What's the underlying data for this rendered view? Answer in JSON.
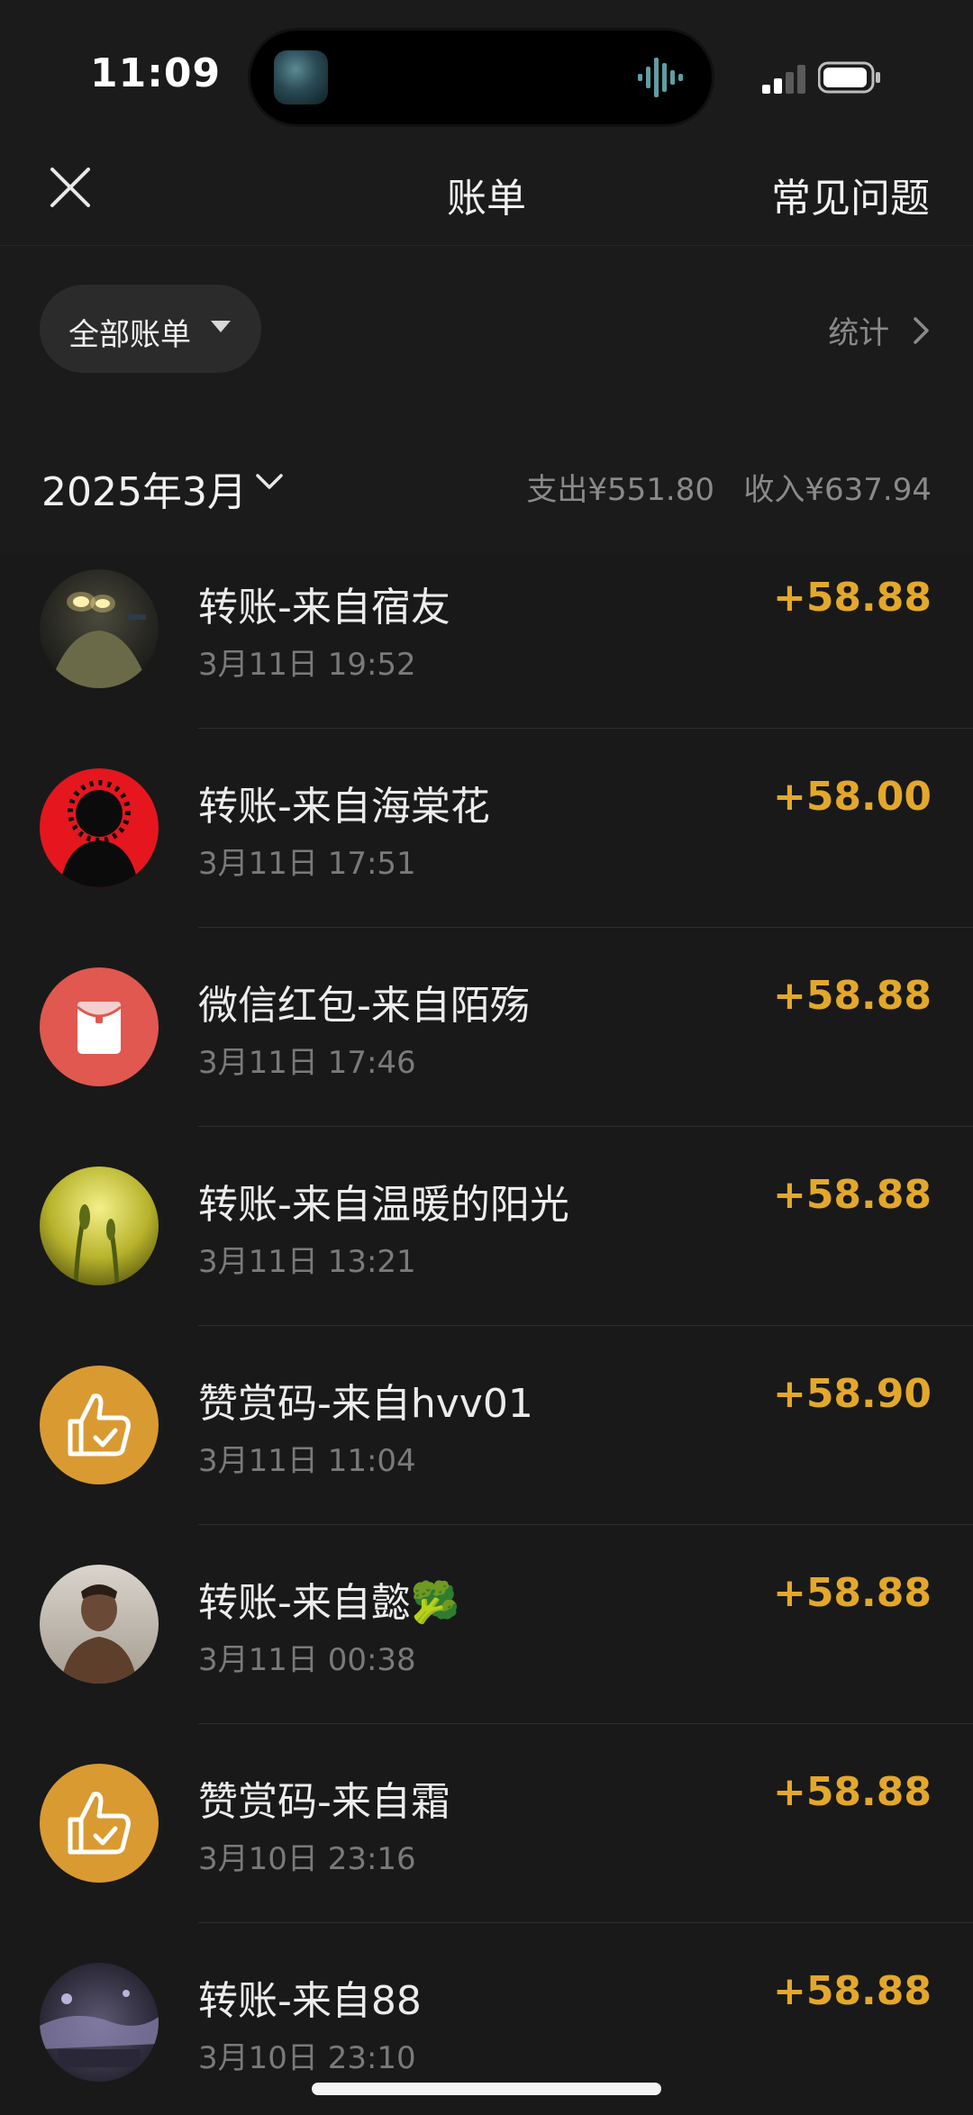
{
  "status_bar": {
    "time": "11:09",
    "signal_icon": "cellular-signal-icon",
    "battery_icon": "battery-icon"
  },
  "nav": {
    "close_icon": "close-icon",
    "title": "账单",
    "faq_label": "常见问题"
  },
  "filter": {
    "label": "全部账单",
    "caret_icon": "caret-down-icon",
    "stats_label": "统计",
    "stats_icon": "chevron-right-icon"
  },
  "month": {
    "label": "2025年3月",
    "chevron_icon": "chevron-down-icon",
    "summary": "支出¥551.80   收入¥637.94"
  },
  "colors": {
    "background": "#1b1b1b",
    "amount": "#e3a82b",
    "red_packet": "#e0584f",
    "reward_code": "#d99a32"
  },
  "transactions": [
    {
      "title": "转账-来自宿友",
      "time": "3月11日 19:52",
      "amount": "+58.88",
      "avatar": "photo-avatar-glowing-eyes"
    },
    {
      "title": "转账-来自海棠花",
      "time": "3月11日 17:51",
      "amount": "+58.00",
      "avatar": "photo-avatar-silhouette-red"
    },
    {
      "title": "微信红包-来自陌殇",
      "time": "3月11日 17:46",
      "amount": "+58.88",
      "avatar": "red-packet-icon"
    },
    {
      "title": "转账-来自温暖的阳光",
      "time": "3月11日 13:21",
      "amount": "+58.88",
      "avatar": "photo-avatar-wheat"
    },
    {
      "title": "赞赏码-来自hvv01",
      "time": "3月11日 11:04",
      "amount": "+58.90",
      "avatar": "thumbs-up-check-icon"
    },
    {
      "title": "转账-来自懿🥦",
      "time": "3月11日 00:38",
      "amount": "+58.88",
      "avatar": "photo-avatar-portrait"
    },
    {
      "title": "赞赏码-来自霜",
      "time": "3月10日 23:16",
      "amount": "+58.88",
      "avatar": "thumbs-up-check-icon"
    },
    {
      "title": "转账-来自88",
      "time": "3月10日 23:10",
      "amount": "+58.88",
      "avatar": "photo-avatar-night-scene"
    }
  ]
}
